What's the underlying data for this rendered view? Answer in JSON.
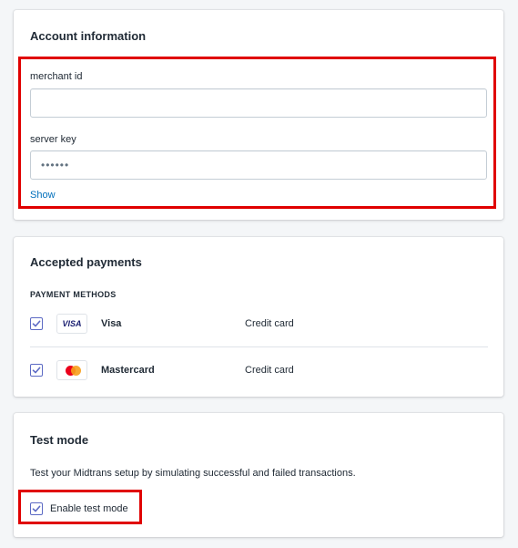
{
  "account": {
    "title": "Account information",
    "merchant_id_label": "merchant id",
    "merchant_id_value": "",
    "server_key_label": "server key",
    "server_key_value": "••••••",
    "show_label": "Show"
  },
  "payments": {
    "title": "Accepted payments",
    "section_label": "PAYMENT METHODS",
    "methods": [
      {
        "name": "Visa",
        "type": "Credit card",
        "badge": "VISA",
        "checked": true
      },
      {
        "name": "Mastercard",
        "type": "Credit card",
        "badge": "mastercard-logo",
        "checked": true
      }
    ]
  },
  "test_mode": {
    "title": "Test mode",
    "description": "Test your Midtrans setup by simulating successful and failed transactions.",
    "checkbox_label": "Enable test mode",
    "checked": true
  },
  "colors": {
    "highlight": "#e00000",
    "checkbox_accent": "#5c6ac4",
    "link": "#006fbb",
    "mastercard_red": "#eb001b",
    "mastercard_yellow": "#f79e1b"
  }
}
